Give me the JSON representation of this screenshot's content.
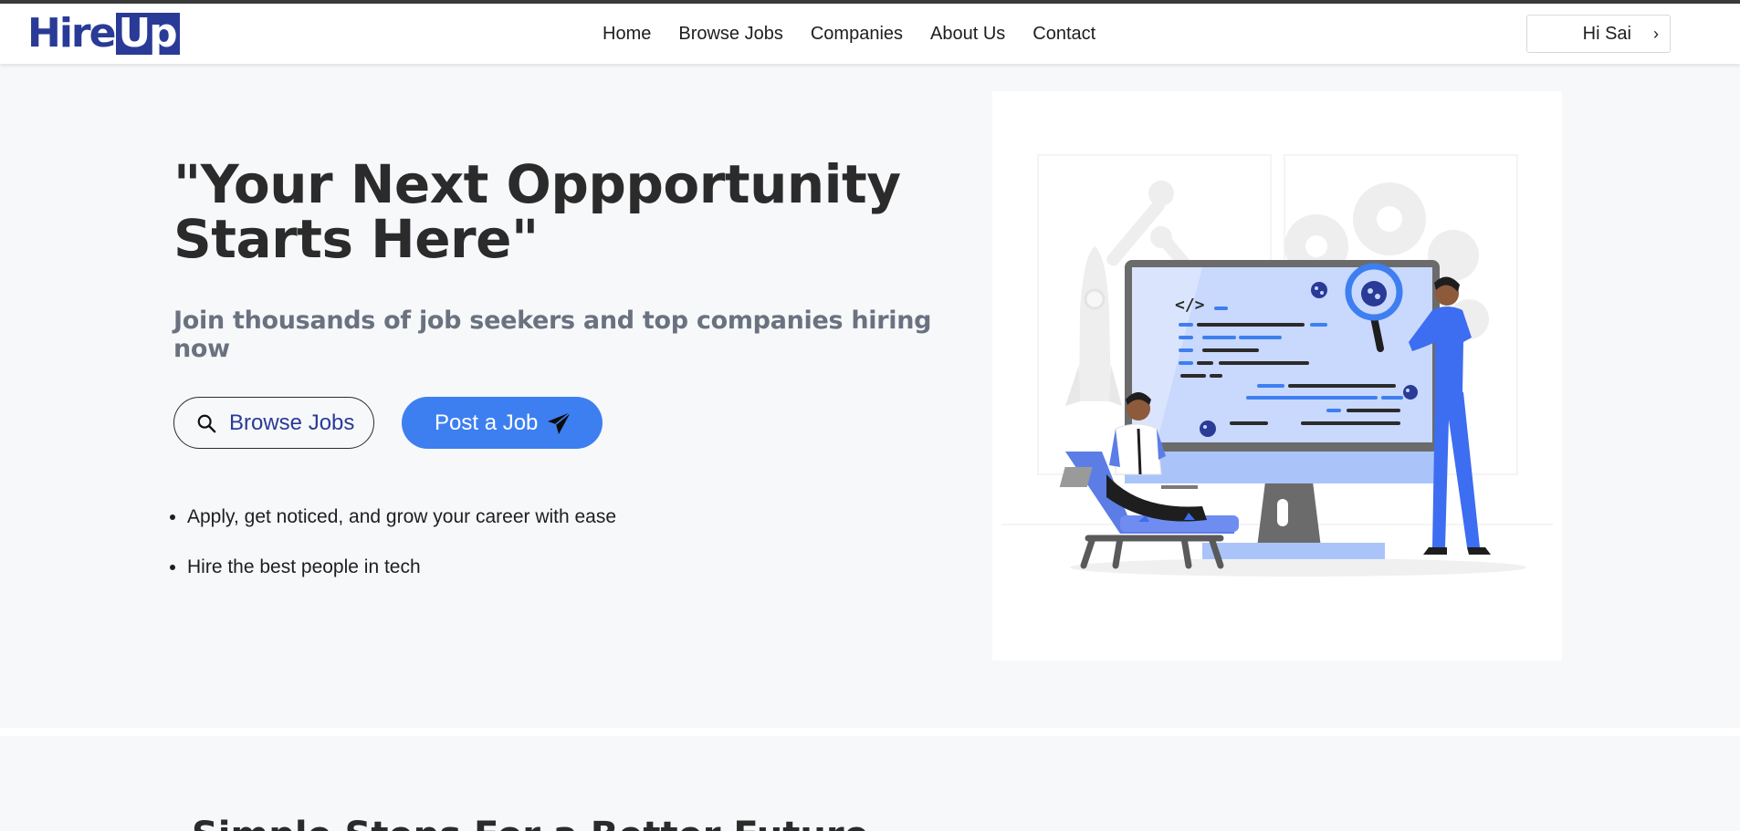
{
  "header": {
    "logo": {
      "part1": "Hire",
      "part2": "Up"
    },
    "nav": [
      "Home",
      "Browse Jobs",
      "Companies",
      "About Us",
      "Contact"
    ],
    "user_greeting": "Hi Sai",
    "user_chevron": "›"
  },
  "hero": {
    "title_line1": "\"Your Next Oppportunity",
    "title_line2": "Starts Here\"",
    "subtitle": "Join thousands of job seekers and top companies hiring now",
    "browse_button": "Browse Jobs",
    "post_button": "Post a Job",
    "features": [
      "Apply, get noticed, and grow your career with ease",
      "Hire the best people in tech"
    ],
    "illustration_code_tag": "</>"
  },
  "next_section": {
    "heading": "Simple Steps For a Better Future"
  },
  "colors": {
    "brand": "#2a3a97",
    "accent": "#3d7ff0",
    "title": "#2b2b2b",
    "subtitle": "#6a7280",
    "background": "#f7f8fa"
  },
  "icons": {
    "browse": "search-icon",
    "post": "paper-plane-icon",
    "user": "chevron-right-icon"
  }
}
